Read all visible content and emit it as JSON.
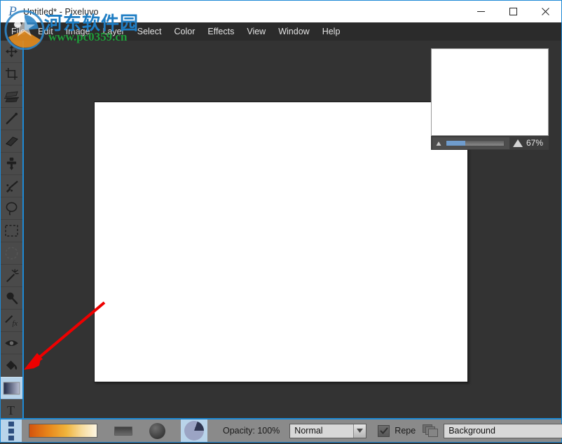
{
  "window": {
    "title": "Untitled* - Pixeluvo",
    "app_icon": "pixeluvo-p-icon",
    "controls": {
      "minimize": "minimize-icon",
      "maximize": "maximize-icon",
      "close": "close-icon"
    }
  },
  "menubar": {
    "items": [
      {
        "label": "File"
      },
      {
        "label": "Edit"
      },
      {
        "label": "Image"
      },
      {
        "label": "Layer"
      },
      {
        "label": "Select"
      },
      {
        "label": "Color"
      },
      {
        "label": "Effects"
      },
      {
        "label": "View"
      },
      {
        "label": "Window"
      },
      {
        "label": "Help"
      }
    ]
  },
  "toolbar": {
    "tools": [
      {
        "name": "move-tool",
        "icon": "move-icon",
        "selected": false
      },
      {
        "name": "crop-tool",
        "icon": "crop-icon",
        "selected": false
      },
      {
        "name": "transform-tool",
        "icon": "transform-icon",
        "selected": false
      },
      {
        "name": "paintbrush-tool",
        "icon": "paintbrush-icon",
        "selected": false
      },
      {
        "name": "eraser-tool",
        "icon": "eraser-icon",
        "selected": false
      },
      {
        "name": "clone-stamp-tool",
        "icon": "clone-stamp-icon",
        "selected": false
      },
      {
        "name": "smudge-tool",
        "icon": "smudge-icon",
        "selected": false
      },
      {
        "name": "lasso-tool",
        "icon": "lasso-icon",
        "selected": false
      },
      {
        "name": "rectangle-select-tool",
        "icon": "rectangle-select-icon",
        "selected": false
      },
      {
        "name": "ellipse-select-tool",
        "icon": "ellipse-select-icon",
        "selected": false
      },
      {
        "name": "magic-wand-tool",
        "icon": "magic-wand-icon",
        "selected": false
      },
      {
        "name": "zoom-tool",
        "icon": "magnifier-icon",
        "selected": false
      },
      {
        "name": "effects-brush-tool",
        "icon": "effects-brush-icon",
        "selected": false
      },
      {
        "name": "red-eye-tool",
        "icon": "eye-icon",
        "selected": false
      },
      {
        "name": "paint-bucket-tool",
        "icon": "paint-bucket-icon",
        "selected": false
      },
      {
        "name": "gradient-tool",
        "icon": "gradient-icon",
        "selected": true
      },
      {
        "name": "text-tool",
        "icon": "text-t-icon",
        "selected": false
      },
      {
        "name": "shape-tool",
        "icon": "shape-icon",
        "selected": false
      }
    ]
  },
  "navigator": {
    "title": "navigator-panel",
    "zoom_label": "67%",
    "zoom_percent": 67,
    "slider_fill_percent": 33,
    "zoom_out_icon": "small-mountain-icon",
    "zoom_in_icon": "large-mountain-icon",
    "side_tabs": [
      {
        "name": "panel-tab-navigator",
        "active": true
      },
      {
        "name": "panel-tab-layers",
        "active": false
      },
      {
        "name": "panel-tab-history",
        "active": false
      }
    ]
  },
  "options_bar": {
    "menu_icon": "tool-options-menu-icon",
    "gradient_swatch": "orange-to-white-gradient",
    "gradient_shape_rect": "linear-gradient-icon",
    "gradient_shape_sphere": "radial-gradient-icon",
    "gradient_shape_pie": "conical-gradient-icon",
    "opacity_label": "Opacity: 100%",
    "opacity_value": 100,
    "blend_mode": "Normal",
    "blend_mode_options": [
      "Normal"
    ],
    "repeat_label": "Repe",
    "repeat_checked": true,
    "layers_icon": "layers-icon",
    "layer_name": "Background",
    "layer_options": [
      "Background"
    ],
    "dropdown_arrow_icon": "chevron-down-icon"
  },
  "canvas": {
    "name": "image-canvas",
    "background": "#ffffff"
  },
  "annotation": {
    "arrow": "red-arrow-pointing-to-gradient-tool",
    "color": "#ee0000"
  },
  "watermark": {
    "site_name": "河东软件园",
    "url": "www.pc0359.cn",
    "logo": "watermark-logo-icon"
  },
  "colors": {
    "accent": "#1e8ad6",
    "menubar_bg": "#2b2b2b",
    "toolbar_bg": "#4a4a4a",
    "workspace_bg": "#333333",
    "bottombar_bg": "#8a8a8a",
    "selected_tool_bg": "#b9d4ea",
    "slider_fill": "#6f9ccd"
  }
}
